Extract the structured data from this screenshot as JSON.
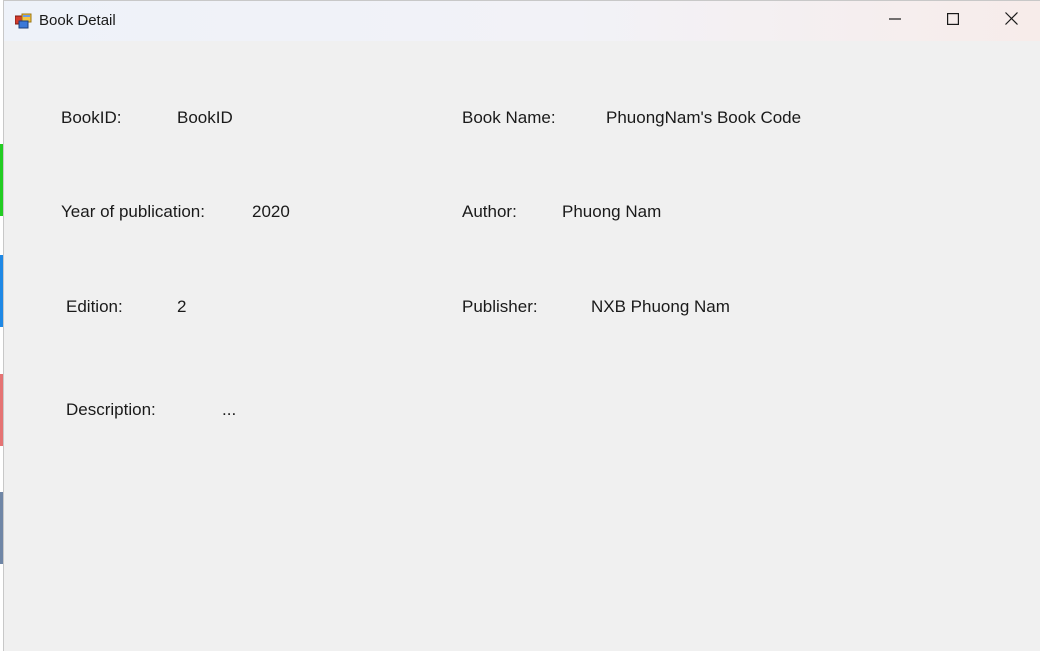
{
  "window": {
    "title": "Book Detail",
    "icon": "app-form-icon"
  },
  "controls": {
    "minimize_icon": "minimize-icon",
    "maximize_icon": "maximize-icon",
    "close_icon": "close-icon"
  },
  "fields": {
    "book_id": {
      "label": "BookID:",
      "value": "BookID"
    },
    "book_name": {
      "label": "Book Name:",
      "value": "PhuongNam's Book Code"
    },
    "year": {
      "label": "Year of publication:",
      "value": "2020"
    },
    "author": {
      "label": "Author:",
      "value": "Phuong Nam"
    },
    "edition": {
      "label": "Edition:",
      "value": "2"
    },
    "publisher": {
      "label": "Publisher:",
      "value": "NXB Phuong Nam"
    },
    "description": {
      "label": "Description:",
      "value": "..."
    }
  },
  "colors": {
    "client_bg": "#f0f0f0",
    "text": "#1a1a1a",
    "left_strip_green": "#22cc22",
    "left_strip_blue": "#1e88e5",
    "left_strip_red": "#e57373",
    "left_strip_slate": "#6f86a6"
  }
}
